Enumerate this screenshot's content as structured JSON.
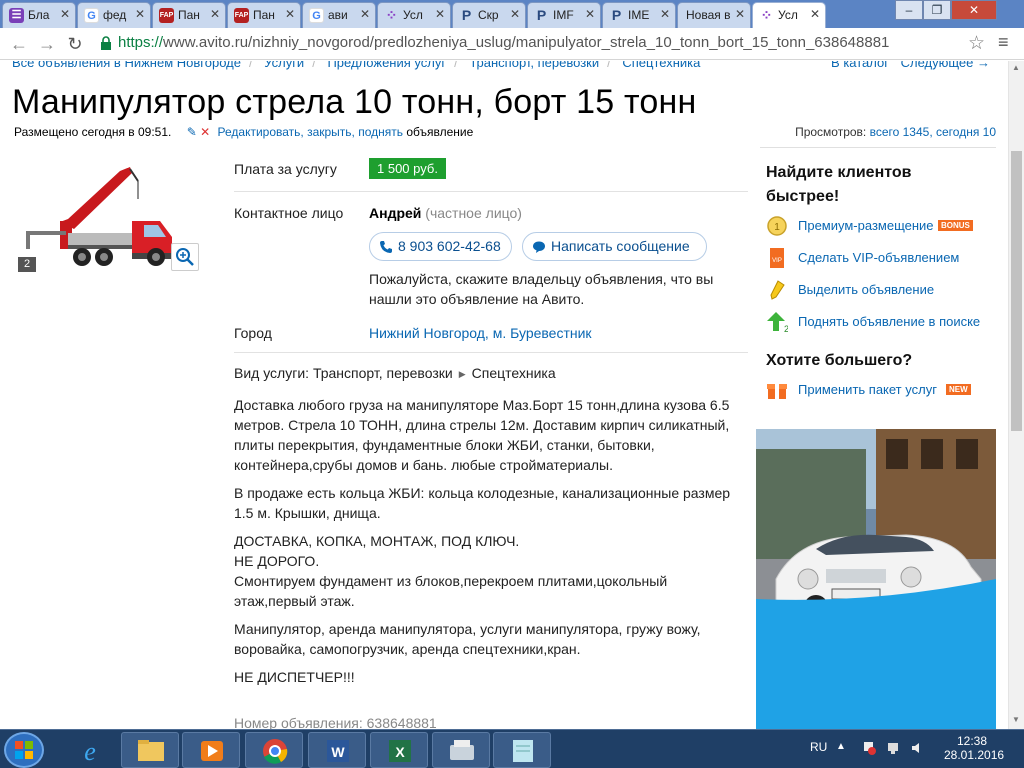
{
  "browser": {
    "tabs": [
      {
        "icon": "list-icon",
        "label": "Бла"
      },
      {
        "icon": "google-icon",
        "label": "фед"
      },
      {
        "icon": "fap-icon",
        "label": "Пан"
      },
      {
        "icon": "fap-icon",
        "label": "Пан"
      },
      {
        "icon": "google-icon",
        "label": "ави"
      },
      {
        "icon": "avito-icon",
        "label": "Усл"
      },
      {
        "icon": "p-icon",
        "label": "Скр"
      },
      {
        "icon": "p-icon",
        "label": "IMF"
      },
      {
        "icon": "p-icon",
        "label": "IME"
      },
      {
        "icon": "none",
        "label": "Новая в"
      },
      {
        "icon": "avito-icon",
        "label": "Усл"
      }
    ],
    "url_scheme": "https://",
    "url_rest": "www.avito.ru/nizhniy_novgorod/predlozheniya_uslug/manipulyator_strela_10_tonn_bort_15_tonn_638648881"
  },
  "breadcrumbs": {
    "items": [
      "Все объявления в Нижнем Новгороде",
      "Услуги",
      "Предложения услуг",
      "Транспорт, перевозки",
      "Спецтехника"
    ],
    "to_catalog": "В каталог",
    "next": "Следующее →"
  },
  "listing": {
    "title": "Манипулятор стрела 10 тонн, борт 15 тонн",
    "posted": "Размещено сегодня в 09:51.",
    "edit_links": "Редактировать, закрыть, поднять",
    "edit_suffix": " объявление",
    "views_label": "Просмотров: ",
    "views_value": "всего 1345, сегодня 10",
    "photo_count": "2",
    "price_label": "Плата за услугу",
    "price": "1 500 руб.",
    "contact_label": "Контактное лицо",
    "contact_name": "Андрей",
    "contact_type": " (частное лицо)",
    "phone": "8 903 602-42-68",
    "message_button": "Написать сообщение",
    "hint": "Пожалуйста, скажите владельцу объявления, что вы нашли это объявление на Авито.",
    "city_label": "Город",
    "city": "Нижний Новгород, м. Буревестник",
    "service_type_label": "Вид услуги: ",
    "service_type_a": "Транспорт, перевозки",
    "service_type_b": "Спецтехника",
    "description": [
      "Доставка любого груза на манипуляторе Маз.Борт 15 тонн,длина кузова 6.5 метров. Стрела 10 ТОНН, длина стрелы 12м. Доставим кирпич силикатный, плиты перекрытия, фундаментные блоки ЖБИ, станки, бытовки, контейнера,срубы домов и бань. любые стройматериалы.",
      "В продаже есть кольца ЖБИ: кольца колодезные, канализационные размер 1.5 м. Крышки, днища.",
      "ДОСТАВКА, КОПКА, МОНТАЖ, ПОД КЛЮЧ.\nНЕ ДОРОГО.\nСмонтируем фундамент из блоков,перекроем плитами,цокольный этаж,первый этаж.",
      "Манипулятор, аренда манипулятора, услуги манипулятора, гружу вожу, воровайка, самопогрузчик, аренда спецтехники,кран.",
      "НЕ ДИСПЕТЧЕР!!!"
    ],
    "ad_number": "Номер объявления: 638648881"
  },
  "sidebar": {
    "heading": "Найдите клиентов быстрее!",
    "items": [
      {
        "icon": "premium-medal-icon",
        "label": "Премиум-размещение",
        "badge": "BONUS"
      },
      {
        "icon": "vip-icon",
        "label": "Сделать VIP-объявлением",
        "badge": ""
      },
      {
        "icon": "highlighter-icon",
        "label": "Выделить объявление",
        "badge": ""
      },
      {
        "icon": "raise-arrow-icon",
        "label": "Поднять объявление в поиске",
        "badge": ""
      }
    ],
    "heading2": "Хотите большего?",
    "package": {
      "icon": "gift-box-icon",
      "label": "Применить пакет услуг",
      "badge": "NEW"
    }
  },
  "taskbar": {
    "lang": "RU",
    "time": "12:38",
    "date": "28.01.2016"
  },
  "colors": {
    "link": "#0a67b2",
    "price_badge": "#1e9f2f",
    "bonus_badge": "#f26c21",
    "new_badge": "#f26c21"
  }
}
